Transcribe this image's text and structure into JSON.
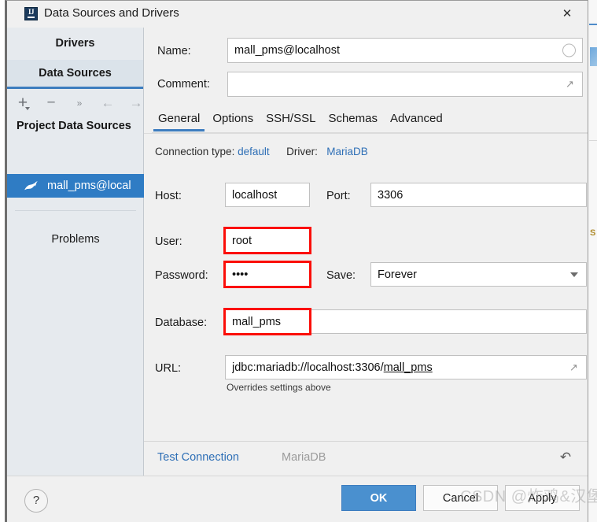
{
  "window": {
    "title": "Data Sources and Drivers",
    "app_icon": "intellij-idea-icon",
    "close_label": "✕"
  },
  "sidebar": {
    "tabs": [
      {
        "label": "Drivers",
        "selected": false
      },
      {
        "label": "Data Sources",
        "selected": true
      }
    ],
    "toolbar": [
      {
        "icon": "add-icon",
        "glyph": "+"
      },
      {
        "icon": "remove-icon",
        "glyph": "−"
      },
      {
        "icon": "more-chevron-icon",
        "glyph": "»"
      },
      {
        "icon": "back-arrow-icon",
        "glyph": "←"
      },
      {
        "icon": "forward-arrow-icon",
        "glyph": "→"
      }
    ],
    "group_header": "Project Data Sources",
    "data_source": {
      "label": "mall_pms@local",
      "icon": "mariadb-seal-icon",
      "selected": true
    },
    "problems_label": "Problems"
  },
  "form": {
    "name_label": "Name:",
    "name_value": "mall_pms@localhost",
    "name_color_icon": "color-circle-icon",
    "comment_label": "Comment:",
    "comment_value": "",
    "comment_expand_icon": "expand-icon"
  },
  "tabs": [
    {
      "label": "General",
      "selected": true
    },
    {
      "label": "Options",
      "selected": false
    },
    {
      "label": "SSH/SSL",
      "selected": false
    },
    {
      "label": "Schemas",
      "selected": false
    },
    {
      "label": "Advanced",
      "selected": false
    }
  ],
  "general": {
    "connection_type_label": "Connection type:",
    "connection_type_value": "default",
    "driver_label": "Driver:",
    "driver_value": "MariaDB",
    "host_label": "Host:",
    "host_value": "localhost",
    "port_label": "Port:",
    "port_value": "3306",
    "user_label": "User:",
    "user_value": "root",
    "password_label": "Password:",
    "password_value": "••••",
    "save_label": "Save:",
    "save_value": "Forever",
    "database_label": "Database:",
    "database_value": "mall_pms",
    "url_label": "URL:",
    "url_prefix": "jdbc:mariadb://localhost:3306/",
    "url_db": "mall_pms",
    "url_hint": "Overrides settings above",
    "url_expand_icon": "expand-icon"
  },
  "action_bar": {
    "test_connection_label": "Test Connection",
    "driver_status": "MariaDB",
    "revert_icon": "revert-arrow-icon"
  },
  "footer": {
    "help_label": "?",
    "ok_label": "OK",
    "cancel_label": "Cancel",
    "apply_label": "Apply"
  },
  "watermark": "CSDN @炸鸡&汉堡",
  "colors": {
    "accent_blue": "#3d7dbf",
    "selection_blue": "#2f7cc4",
    "link_blue": "#2e6fb6",
    "highlight_red": "#fb0e09",
    "sidebar_bg": "#e6eaee",
    "panel_bg": "#f0f0f0"
  }
}
